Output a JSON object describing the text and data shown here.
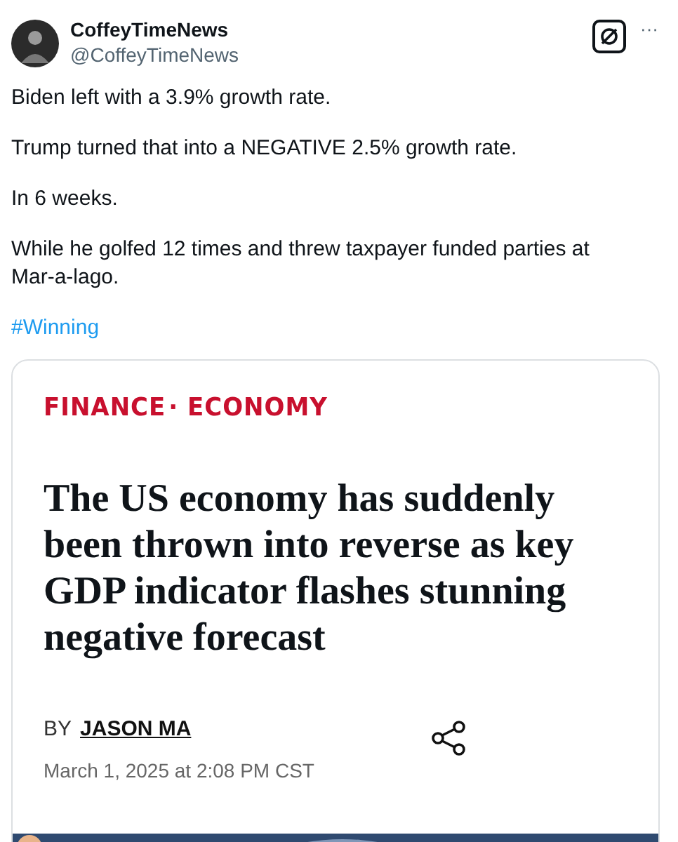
{
  "author": {
    "name": "CoffeyTimeNews",
    "handle": "@CoffeyTimeNews"
  },
  "more_button": "···",
  "paragraphs": [
    {
      "kind": "text",
      "text": "Biden left with a 3.9% growth rate."
    },
    {
      "kind": "text",
      "text": "Trump turned that into a NEGATIVE 2.5% growth rate."
    },
    {
      "kind": "text",
      "text": "In 6 weeks."
    },
    {
      "kind": "text",
      "text": "While he golfed 12 times and threw taxpayer funded parties at Mar-a-lago."
    },
    {
      "kind": "hashtag",
      "text": "#Winning"
    }
  ],
  "article": {
    "section": "FINANCE",
    "subsection": "· ECONOMY",
    "headline": "The US economy has suddenly been thrown into reverse as key GDP indicator flashes stunning negative forecast",
    "by": "BY",
    "author": "JASON MA",
    "date": "March 1, 2025 at 2:08 PM CST"
  }
}
